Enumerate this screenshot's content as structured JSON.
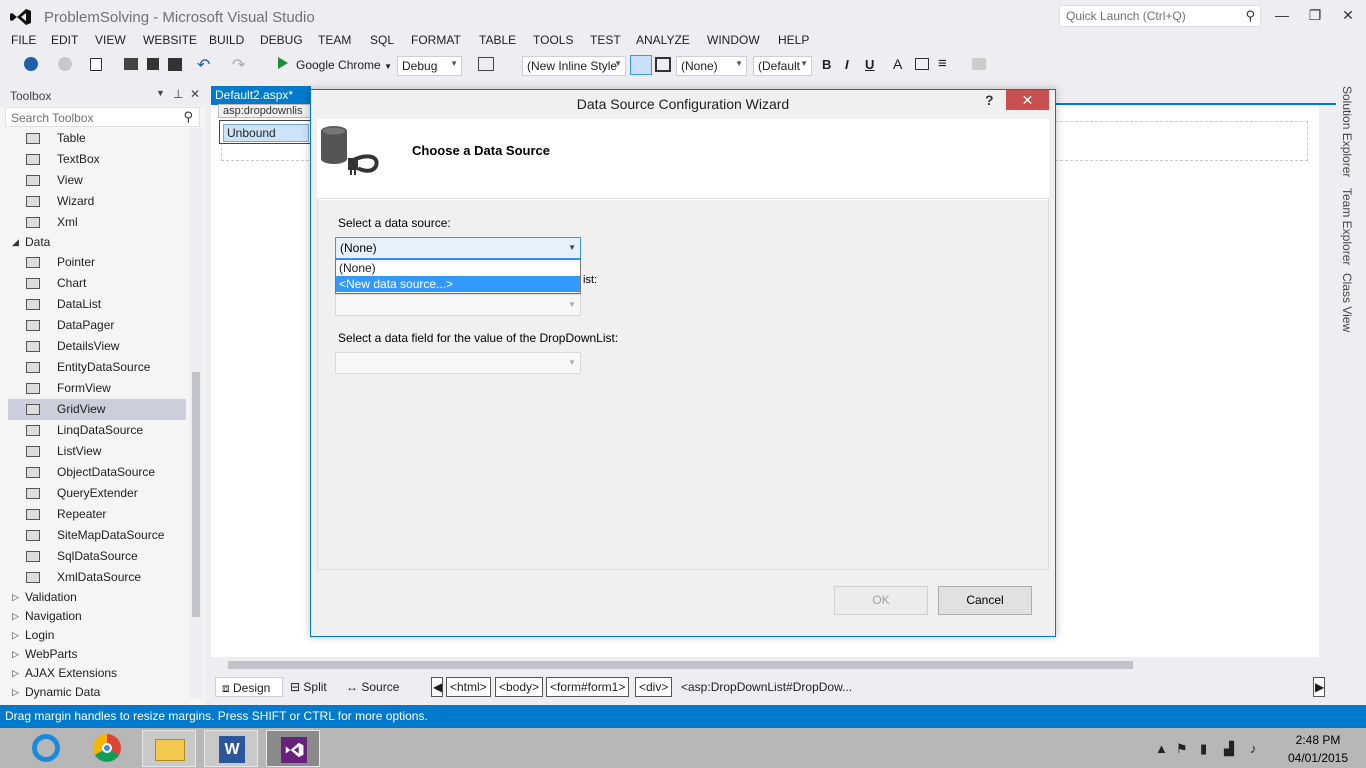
{
  "window": {
    "title": "ProblemSolving - Microsoft Visual Studio",
    "quick_launch_placeholder": "Quick Launch (Ctrl+Q)"
  },
  "menu": [
    "FILE",
    "EDIT",
    "VIEW",
    "WEBSITE",
    "BUILD",
    "DEBUG",
    "TEAM",
    "SQL",
    "FORMAT",
    "TABLE",
    "TOOLS",
    "TEST",
    "ANALYZE",
    "WINDOW",
    "HELP"
  ],
  "toolbar": {
    "run_target": "Google Chrome",
    "config": "Debug",
    "style_combo": "(New Inline Style",
    "target_rule": "(None)",
    "font_combo": "(Default",
    "bold": "B",
    "italic": "I",
    "underline": "U"
  },
  "toolbox": {
    "title": "Toolbox",
    "search_placeholder": "Search Toolbox",
    "items_top": [
      "Table",
      "TextBox",
      "View",
      "Wizard",
      "Xml"
    ],
    "data_category": "Data",
    "data_items": [
      "Pointer",
      "Chart",
      "DataList",
      "DataPager",
      "DetailsView",
      "EntityDataSource",
      "FormView",
      "GridView",
      "LinqDataSource",
      "ListView",
      "ObjectDataSource",
      "QueryExtender",
      "Repeater",
      "SiteMapDataSource",
      "SqlDataSource",
      "XmlDataSource"
    ],
    "selected": "GridView",
    "categories_bottom": [
      "Validation",
      "Navigation",
      "Login",
      "WebParts",
      "AJAX Extensions",
      "Dynamic Data"
    ]
  },
  "editor": {
    "tab": "Default2.aspx*",
    "control_caption": "asp:dropdownlis",
    "control_text": "Unbound",
    "views": [
      "Design",
      "Split",
      "Source"
    ],
    "breadcrumb": [
      "<html>",
      "<body>",
      "<form#form1>",
      "<div>"
    ],
    "breadcrumb_current": "<asp:DropDownList#DropDow..."
  },
  "right_panels": [
    "Solution Explorer",
    "Team Explorer",
    "Class View"
  ],
  "dialog": {
    "title": "Data Source Configuration Wizard",
    "help": "?",
    "heading": "Choose a Data Source",
    "select_label": "Select a data source:",
    "select_value": "(None)",
    "options": [
      "(None)",
      "<New data source...>"
    ],
    "display_label_tail": "ist:",
    "value_label": "Select a data field for the value of the DropDownList:",
    "ok": "OK",
    "cancel": "Cancel"
  },
  "status": "Drag margin handles to resize margins. Press SHIFT or CTRL for more options.",
  "clock": {
    "time": "2:48 PM",
    "date": "04/01/2015"
  },
  "colors": {
    "accent": "#007acc",
    "close": "#c75050",
    "selection": "#3399ff"
  }
}
